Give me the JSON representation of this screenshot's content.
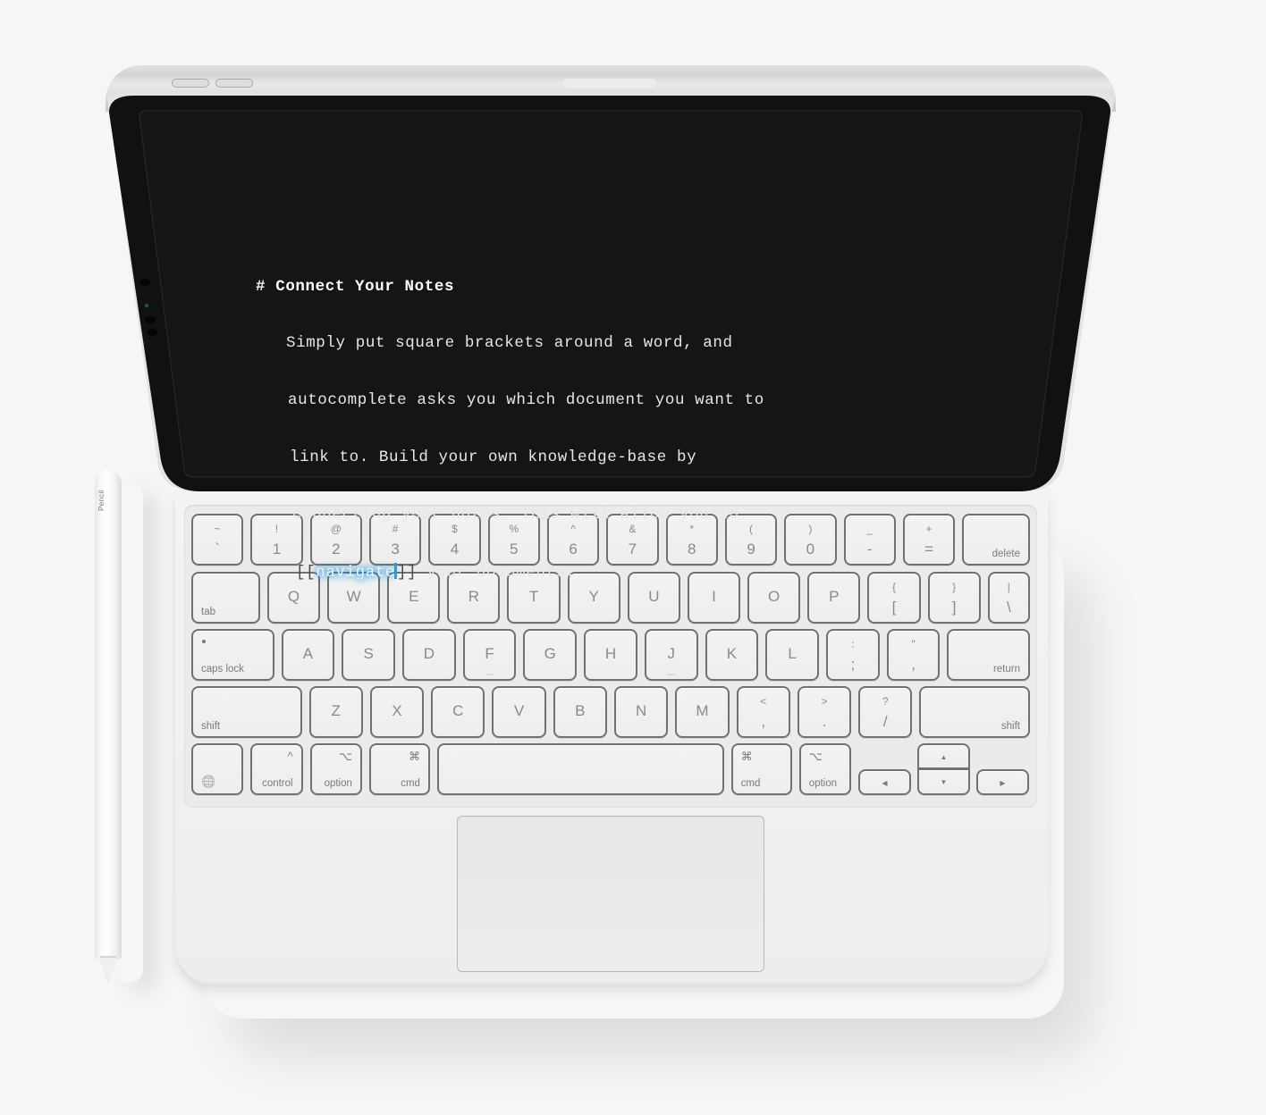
{
  "device": {
    "name": "iPad with Magic Keyboard",
    "accessory_label": "Pencil"
  },
  "editor": {
    "heading_marker": "#",
    "heading": "Connect Your Notes",
    "lines": [
      "Simply put square brackets around a word, and",
      "autocomplete asks you which document you want to",
      "link to. Build your own knowledge-base by",
      "connecting your notes. This will allow you to"
    ],
    "last_line": {
      "open_brackets": "[[",
      "link_word": "navigate",
      "close_brackets": "]]",
      "rest": " your documents."
    },
    "colors": {
      "background": "#141414",
      "text": "#e6e6e6",
      "link_glow": "#1aa0e8",
      "caret": "#12a5f0"
    }
  },
  "keyboard": {
    "rows": [
      [
        {
          "main": "`",
          "sub": "~",
          "w": 1
        },
        {
          "main": "1",
          "sub": "!",
          "w": 1
        },
        {
          "main": "2",
          "sub": "@",
          "w": 1
        },
        {
          "main": "3",
          "sub": "#",
          "w": 1
        },
        {
          "main": "4",
          "sub": "$",
          "w": 1
        },
        {
          "main": "5",
          "sub": "%",
          "w": 1
        },
        {
          "main": "6",
          "sub": "^",
          "w": 1
        },
        {
          "main": "7",
          "sub": "&",
          "w": 1
        },
        {
          "main": "8",
          "sub": "*",
          "w": 1
        },
        {
          "main": "9",
          "sub": "(",
          "w": 1
        },
        {
          "main": "0",
          "sub": ")",
          "w": 1
        },
        {
          "main": "-",
          "sub": "_",
          "w": 1
        },
        {
          "main": "=",
          "sub": "+",
          "w": 1
        },
        {
          "label": "delete",
          "align": "r",
          "w": 1.3
        }
      ],
      [
        {
          "label": "tab",
          "align": "l",
          "w": 1.3
        },
        {
          "letter": "Q",
          "w": 1
        },
        {
          "letter": "W",
          "w": 1
        },
        {
          "letter": "E",
          "w": 1
        },
        {
          "letter": "R",
          "w": 1
        },
        {
          "letter": "T",
          "w": 1
        },
        {
          "letter": "Y",
          "w": 1
        },
        {
          "letter": "U",
          "w": 1
        },
        {
          "letter": "I",
          "w": 1
        },
        {
          "letter": "O",
          "w": 1
        },
        {
          "letter": "P",
          "w": 1
        },
        {
          "main": "[",
          "sub": "{",
          "w": 1
        },
        {
          "main": "]",
          "sub": "}",
          "w": 1
        },
        {
          "main": "\\",
          "sub": "|",
          "w": 0.8
        }
      ],
      [
        {
          "label": "caps lock",
          "align": "l",
          "dot": true,
          "w": 1.55
        },
        {
          "letter": "A",
          "w": 1
        },
        {
          "letter": "S",
          "w": 1
        },
        {
          "letter": "D",
          "w": 1
        },
        {
          "letter": "F",
          "w": 1,
          "bump": true
        },
        {
          "letter": "G",
          "w": 1
        },
        {
          "letter": "H",
          "w": 1
        },
        {
          "letter": "J",
          "w": 1,
          "bump": true
        },
        {
          "letter": "K",
          "w": 1
        },
        {
          "letter": "L",
          "w": 1
        },
        {
          "main": ";",
          "sub": ":",
          "w": 1
        },
        {
          "main": ",",
          "sub": "\"",
          "w": 1
        },
        {
          "label": "return",
          "align": "r",
          "w": 1.55
        }
      ],
      [
        {
          "label": "shift",
          "align": "l",
          "w": 2.05
        },
        {
          "letter": "Z",
          "w": 1
        },
        {
          "letter": "X",
          "w": 1
        },
        {
          "letter": "C",
          "w": 1
        },
        {
          "letter": "V",
          "w": 1
        },
        {
          "letter": "B",
          "w": 1
        },
        {
          "letter": "N",
          "w": 1
        },
        {
          "letter": "M",
          "w": 1
        },
        {
          "main": ",",
          "sub": "<",
          "w": 1
        },
        {
          "main": ".",
          "sub": ">",
          "w": 1
        },
        {
          "main": "/",
          "sub": "?",
          "w": 1
        },
        {
          "label": "shift",
          "align": "r",
          "w": 2.05
        }
      ],
      [
        {
          "icon": "globe",
          "glyph": "🌐",
          "w": 0.9
        },
        {
          "label": "control",
          "symbol": "^",
          "align": "r",
          "w": 0.9
        },
        {
          "label": "option",
          "symbol": "⌥",
          "align": "r",
          "w": 0.9
        },
        {
          "label": "cmd",
          "symbol": "⌘",
          "align": "r",
          "w": 1.05
        },
        {
          "space": true,
          "w": 4.95
        },
        {
          "label": "cmd",
          "symbol": "⌘",
          "align": "l",
          "w": 1.05
        },
        {
          "label": "option",
          "symbol": "⌥",
          "align": "l",
          "w": 0.9
        }
      ]
    ],
    "arrows": {
      "left": "◀",
      "up": "▲",
      "down": "▼",
      "right": "▶"
    }
  }
}
